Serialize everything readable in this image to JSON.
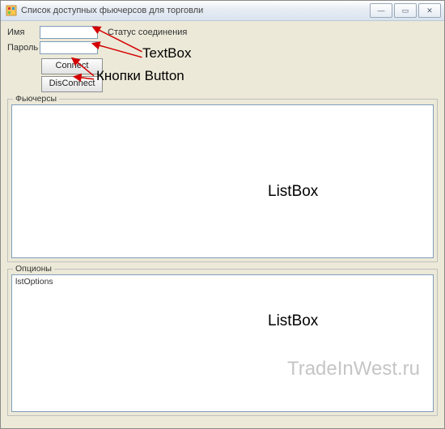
{
  "window": {
    "title": "Список доступных фьючерсов для торговли"
  },
  "controls": {
    "minimize": "—",
    "maximize": "▭",
    "close": "✕"
  },
  "labels": {
    "name": "Имя",
    "password": "Пароль",
    "status": "Статус соединения",
    "futures": "Фьючерсы",
    "options": "Опционы"
  },
  "inputs": {
    "name_value": "",
    "password_value": "",
    "name_placeholder": "",
    "password_placeholder": ""
  },
  "buttons": {
    "connect": "Connect",
    "disconnect": "DisConnect"
  },
  "listboxes": {
    "options_first_item": "lstOptions"
  },
  "annotations": {
    "textbox": "TextBox",
    "buttons": "Кнопки Button",
    "listbox1": "ListBox",
    "listbox2": "ListBox"
  },
  "watermark": "TradeInWest.ru"
}
